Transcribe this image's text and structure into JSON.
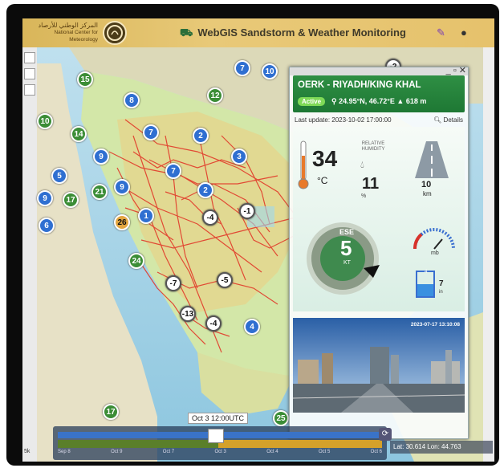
{
  "header": {
    "org_arabic": "المركز الوطني للأرصاد",
    "org_english": "National Center for Meteorology",
    "app_title": "WebGIS Sandstorm & Weather Monitoring",
    "title_icon": "satellite-icon",
    "right_icons": [
      "notification-icon",
      "user-icon"
    ]
  },
  "map": {
    "markers": [
      {
        "label": "15",
        "color": "green"
      },
      {
        "label": "7",
        "color": "blue"
      },
      {
        "label": "10",
        "color": "blue"
      },
      {
        "label": "-2",
        "color": "white"
      },
      {
        "label": "12",
        "color": "green"
      },
      {
        "label": "8",
        "color": "blue"
      },
      {
        "label": "10",
        "color": "green"
      },
      {
        "label": "14",
        "color": "green"
      },
      {
        "label": "7",
        "color": "blue"
      },
      {
        "label": "2",
        "color": "blue"
      },
      {
        "label": "9",
        "color": "blue"
      },
      {
        "label": "3",
        "color": "blue"
      },
      {
        "label": "5",
        "color": "blue"
      },
      {
        "label": "7",
        "color": "blue"
      },
      {
        "label": "21",
        "color": "green"
      },
      {
        "label": "9",
        "color": "blue"
      },
      {
        "label": "2",
        "color": "blue"
      },
      {
        "label": "9",
        "color": "blue"
      },
      {
        "label": "17",
        "color": "green"
      },
      {
        "label": "6",
        "color": "blue"
      },
      {
        "label": "26",
        "color": "orange"
      },
      {
        "label": "1",
        "color": "blue"
      },
      {
        "label": "-4",
        "color": "white"
      },
      {
        "label": "-1",
        "color": "white"
      },
      {
        "label": "24",
        "color": "green"
      },
      {
        "label": "-7",
        "color": "white"
      },
      {
        "label": "-5",
        "color": "white"
      },
      {
        "label": "-13",
        "color": "white"
      },
      {
        "label": "-4",
        "color": "white"
      },
      {
        "label": "4",
        "color": "blue"
      },
      {
        "label": "17",
        "color": "green"
      },
      {
        "label": "25",
        "color": "green"
      }
    ]
  },
  "station": {
    "name": "OERK - RIYADH/KING KHAL",
    "status": "Active",
    "coords": "24.95°N, 46.72°E",
    "elevation": "618 m",
    "last_update": "Last update: 2023-10-02 17:00:00",
    "details_label": "Details",
    "temperature": "34",
    "temperature_unit": "°C",
    "humidity_label": "RELATIVE HUMIDITY",
    "humidity": "11",
    "humidity_unit": "%",
    "visibility": "10",
    "visibility_unit": "km",
    "wind_dir": "ESE",
    "wind_speed": "5",
    "wind_unit": "KT",
    "pressure_unit": "mb",
    "rain_value": "7",
    "rain_unit": "in",
    "rain_scale": "4",
    "camera_timestamp": "2023-07-17 13:10:08"
  },
  "timeline": {
    "current": "Oct 3  12:00UTC",
    "days": [
      "Sep 8",
      "Oct 9",
      "Oct 7",
      "Oct 3",
      "Oct 4",
      "Oct 5",
      "Oct 6"
    ],
    "play_icon": "refresh-icon"
  },
  "status": {
    "coord_text": "Lat: 30.614   Lon: 44.763",
    "corner": "5k"
  },
  "colors": {
    "header": "#e1bf6a",
    "station_head": "#2a8a40",
    "marker_blue": "#2f6fd1",
    "marker_green": "#3b8d36",
    "road_red": "#e23a2a"
  }
}
